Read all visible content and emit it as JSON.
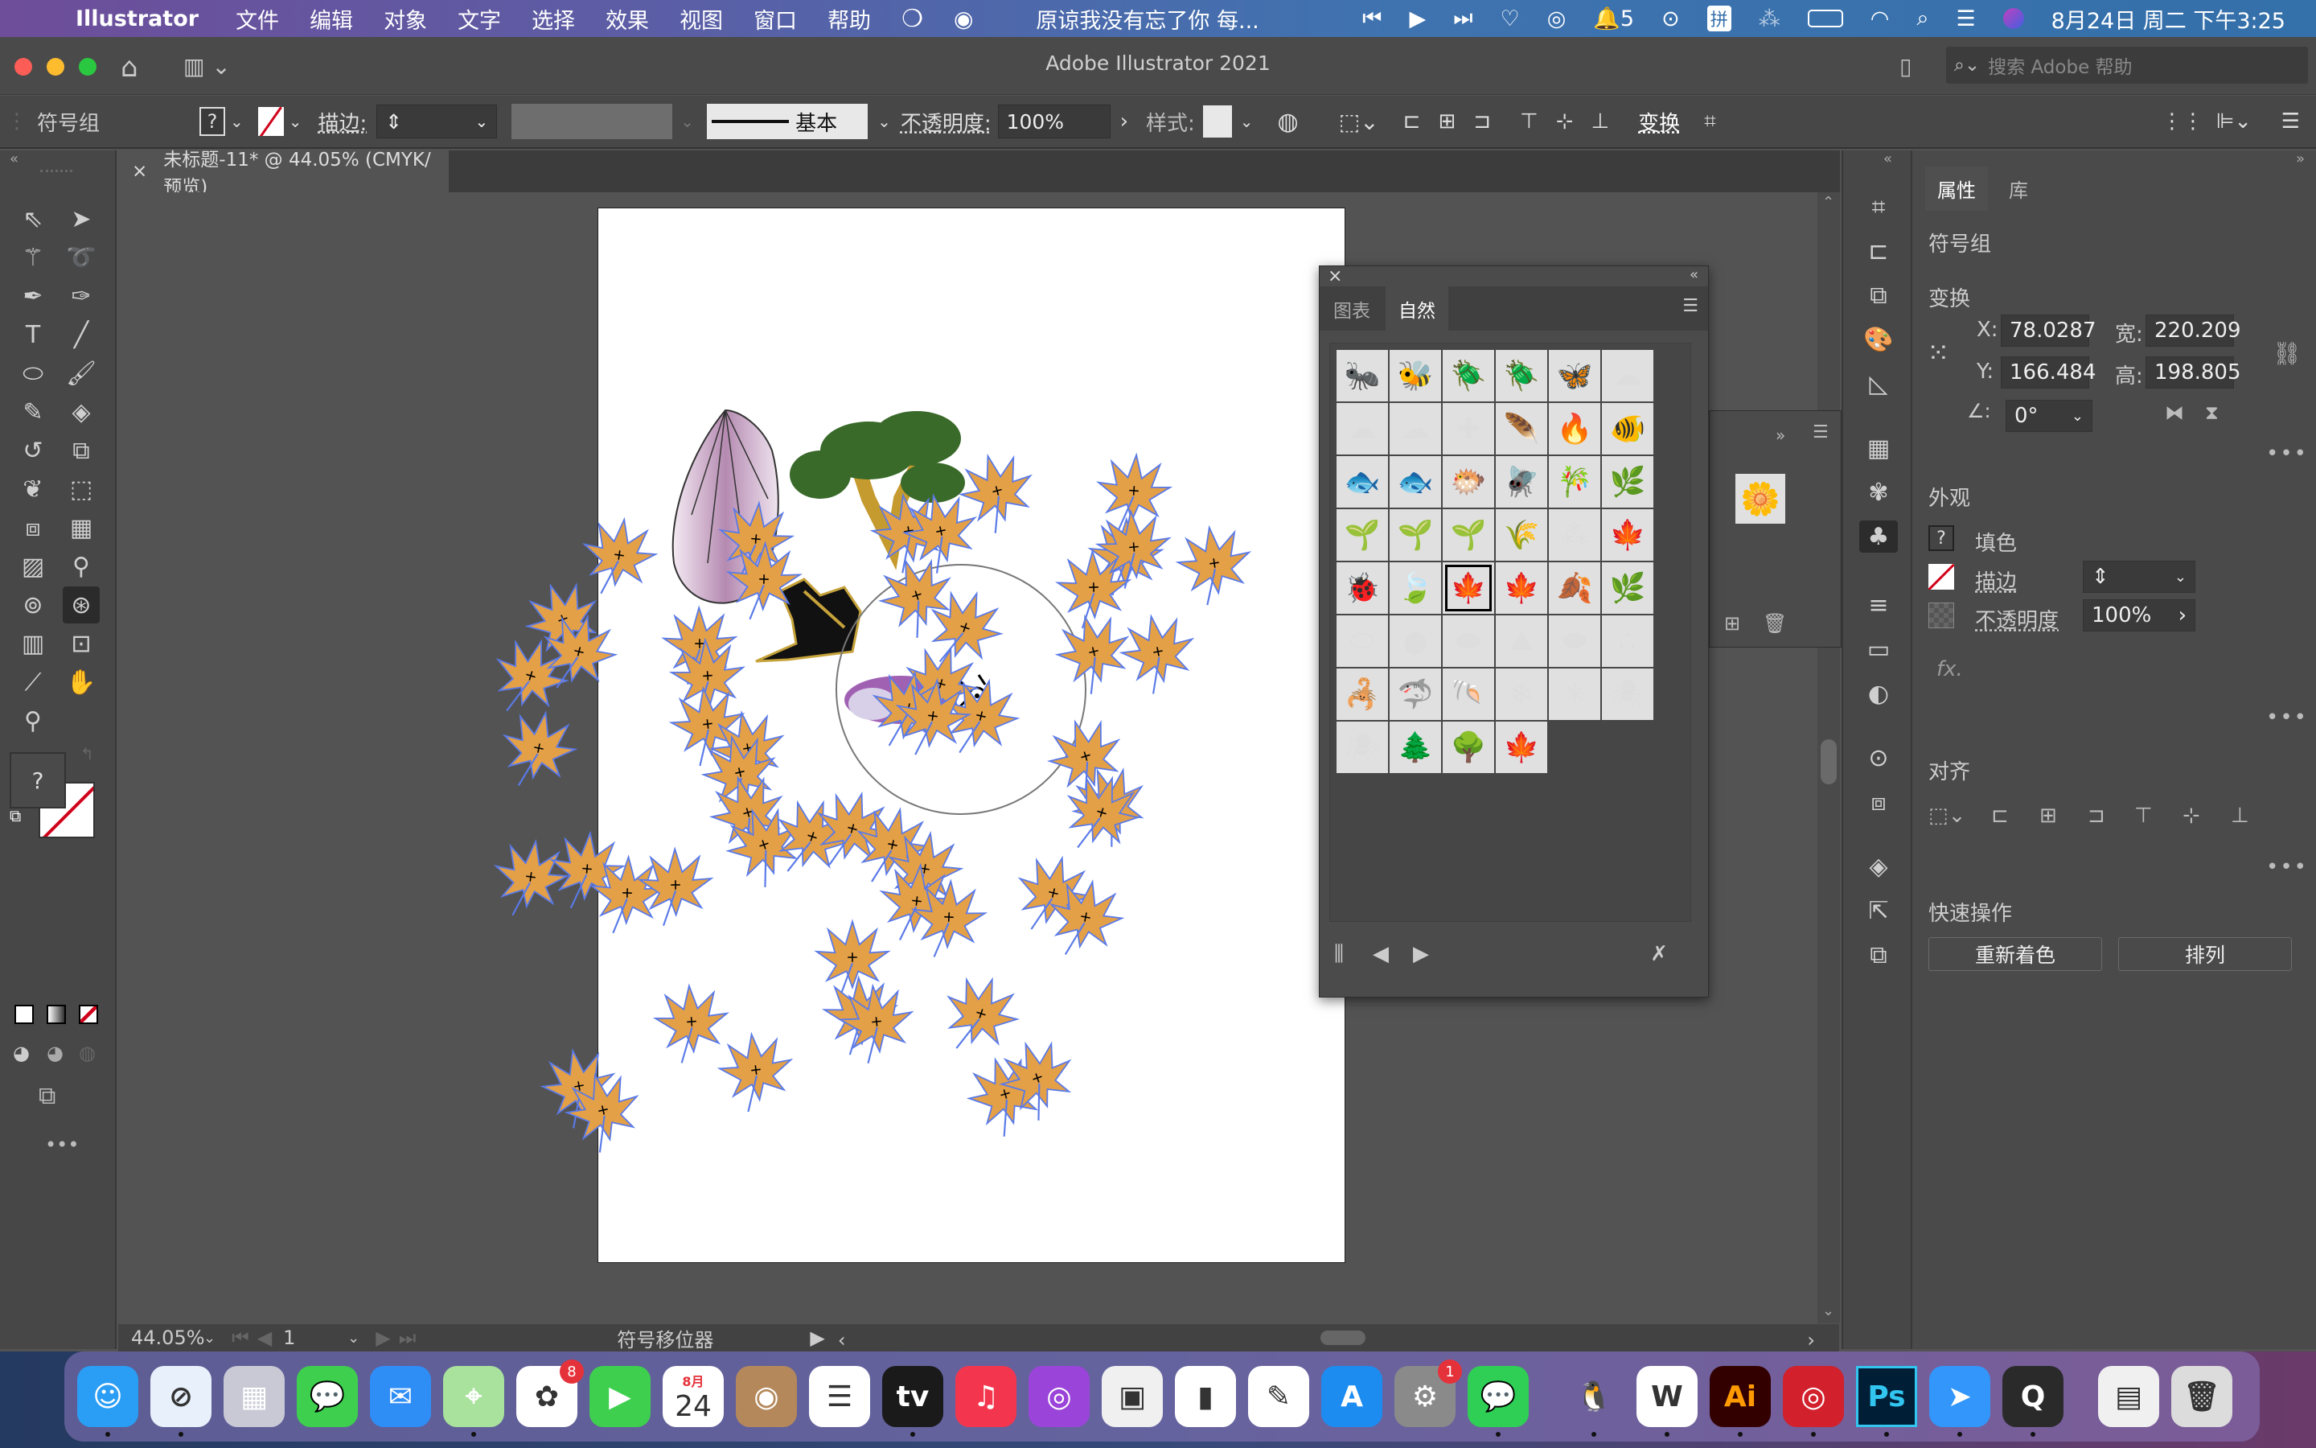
{
  "menubar": {
    "app_name": "Illustrator",
    "menus": [
      "文件",
      "编辑",
      "对象",
      "文字",
      "选择",
      "效果",
      "视图",
      "窗口",
      "帮助"
    ],
    "now_playing": "原谅我没有忘了你 每...",
    "qq_count": "5",
    "input_method": "拼",
    "datetime": "8月24日 周二 下午3:25"
  },
  "window": {
    "title": "Adobe Illustrator 2021",
    "search_placeholder": "搜索 Adobe 帮助"
  },
  "control_bar": {
    "selection_type": "符号组",
    "fill_swatch": "?",
    "stroke_label": "描边:",
    "stroke_profile": "基本",
    "opacity_label": "不透明度:",
    "opacity_value": "100%",
    "style_label": "样式:",
    "transform_label": "变换"
  },
  "document_tab": {
    "title": "未标题-11* @ 44.05% (CMYK/预览)"
  },
  "status_bar": {
    "zoom": "44.05%",
    "artboard_number": "1",
    "current_tool": "符号移位器"
  },
  "symbols_panel": {
    "tabs": [
      {
        "label": "图表",
        "active": false
      },
      {
        "label": "自然",
        "active": true
      }
    ],
    "symbols": [
      {
        "name": "ant",
        "glyph": "🐜"
      },
      {
        "name": "wasp",
        "glyph": "🐝"
      },
      {
        "name": "red-beetle",
        "glyph": "🪲"
      },
      {
        "name": "green-beetle",
        "glyph": "🪲"
      },
      {
        "name": "butterfly",
        "glyph": "🦋"
      },
      {
        "name": "cloud-1",
        "glyph": "☁"
      },
      {
        "name": "cloud-2",
        "glyph": "☁"
      },
      {
        "name": "cloud-3",
        "glyph": "☁"
      },
      {
        "name": "dragonfly",
        "glyph": "✚"
      },
      {
        "name": "feather",
        "glyph": "🪶"
      },
      {
        "name": "fire",
        "glyph": "🔥"
      },
      {
        "name": "orange-fish",
        "glyph": "🐠"
      },
      {
        "name": "angelfish",
        "glyph": "🐟"
      },
      {
        "name": "mahi-fish",
        "glyph": "🐟"
      },
      {
        "name": "purple-fish",
        "glyph": "🐡"
      },
      {
        "name": "fly",
        "glyph": "🪰"
      },
      {
        "name": "bamboo",
        "glyph": "🎋"
      },
      {
        "name": "green-plant",
        "glyph": "🌿"
      },
      {
        "name": "grass-1",
        "glyph": "🌱"
      },
      {
        "name": "grass-2",
        "glyph": "🌱"
      },
      {
        "name": "grass-3",
        "glyph": "🌱"
      },
      {
        "name": "grass-strip",
        "glyph": "🌾"
      },
      {
        "name": "scattered-leaves",
        "glyph": "⁂"
      },
      {
        "name": "yellow-maple",
        "glyph": "🍁"
      },
      {
        "name": "ladybug",
        "glyph": "🐞"
      },
      {
        "name": "green-leaf",
        "glyph": "🍃"
      },
      {
        "name": "orange-maple",
        "glyph": "🍁",
        "selected": true
      },
      {
        "name": "red-maple",
        "glyph": "🍁"
      },
      {
        "name": "brown-maple",
        "glyph": "🍂"
      },
      {
        "name": "oak-leaf",
        "glyph": "🌿"
      },
      {
        "name": "pebble-1",
        "glyph": "⬭"
      },
      {
        "name": "pebble-2",
        "glyph": "●"
      },
      {
        "name": "stone-flat",
        "glyph": "⬬"
      },
      {
        "name": "rock",
        "glyph": "⛰"
      },
      {
        "name": "stone-round",
        "glyph": "⬬"
      },
      {
        "name": "sand",
        "glyph": "∴"
      },
      {
        "name": "scorpion",
        "glyph": "🦂"
      },
      {
        "name": "shark",
        "glyph": "🦈"
      },
      {
        "name": "nautilus",
        "glyph": "🐚"
      },
      {
        "name": "snowflake-1",
        "glyph": "❄"
      },
      {
        "name": "snowflake-2",
        "glyph": "✳"
      },
      {
        "name": "blue-spider",
        "glyph": "🕷"
      },
      {
        "name": "brown-spider",
        "glyph": "🕷"
      },
      {
        "name": "pine-tree",
        "glyph": "🌲"
      },
      {
        "name": "birch-trees",
        "glyph": "🌳"
      },
      {
        "name": "green-maple",
        "glyph": "🍁"
      }
    ]
  },
  "properties_panel": {
    "tabs": [
      {
        "label": "属性",
        "active": true
      },
      {
        "label": "库",
        "active": false
      }
    ],
    "selection_type": "符号组",
    "transform": {
      "heading": "变换",
      "x_label": "X:",
      "x": "78.0287",
      "y_label": "Y:",
      "y": "166.484",
      "w_label": "宽:",
      "w": "220.209",
      "h_label": "高:",
      "h": "198.805",
      "angle": "0°"
    },
    "appearance": {
      "heading": "外观",
      "fill_label": "填色",
      "fill_swatch": "?",
      "stroke_label": "描边",
      "opacity_label": "不透明度",
      "opacity_value": "100%",
      "fx_label": "fx."
    },
    "align": {
      "heading": "对齐"
    },
    "quick_actions": {
      "heading": "快速操作",
      "recolor": "重新着色",
      "arrange": "排列"
    }
  },
  "dock": {
    "apps": [
      {
        "name": "finder",
        "label": "☺",
        "bg": "#2a9df4",
        "running": true
      },
      {
        "name": "safari",
        "label": "⊘",
        "bg": "#e8f1fb",
        "running": true
      },
      {
        "name": "launchpad",
        "label": "▦",
        "bg": "#c9c9d6",
        "running": false
      },
      {
        "name": "messages",
        "label": "💬",
        "bg": "#3ecf4f",
        "running": false
      },
      {
        "name": "mail",
        "label": "✉",
        "bg": "#2f8df6",
        "running": false
      },
      {
        "name": "maps",
        "label": "⌖",
        "bg": "#a8e29c",
        "running": true
      },
      {
        "name": "photos",
        "label": "✿",
        "bg": "#ffffff",
        "running": false,
        "badge": "8"
      },
      {
        "name": "facetime",
        "label": "▶",
        "bg": "#3ecf4f",
        "running": false
      },
      {
        "name": "calendar",
        "label": "24",
        "bg": "#ffffff",
        "running": false,
        "month": "8月"
      },
      {
        "name": "contacts",
        "label": "◉",
        "bg": "#b4885a",
        "running": false
      },
      {
        "name": "reminders",
        "label": "☰",
        "bg": "#ffffff",
        "running": false
      },
      {
        "name": "apple-tv",
        "label": "tv",
        "bg": "#1a1a1a",
        "running": true
      },
      {
        "name": "music",
        "label": "♫",
        "bg": "#f3364e",
        "running": false
      },
      {
        "name": "podcasts",
        "label": "◎",
        "bg": "#9b44d9",
        "running": false
      },
      {
        "name": "keynote",
        "label": "▣",
        "bg": "#f0f0f0",
        "running": false
      },
      {
        "name": "numbers",
        "label": "▮",
        "bg": "#ffffff",
        "running": false
      },
      {
        "name": "pages",
        "label": "✎",
        "bg": "#ffffff",
        "running": false
      },
      {
        "name": "app-store",
        "label": "A",
        "bg": "#1d8cf0",
        "running": false
      },
      {
        "name": "system-preferences",
        "label": "⚙",
        "bg": "#8a8a8a",
        "running": false,
        "badge": "1"
      },
      {
        "name": "wechat",
        "label": "💬",
        "bg": "#2fcf55",
        "running": true
      },
      {
        "name": "qq",
        "label": "🐧",
        "bg": "transparent",
        "running": true
      },
      {
        "name": "wps",
        "label": "W",
        "bg": "#ffffff",
        "running": true
      },
      {
        "name": "illustrator",
        "label": "Ai",
        "bg": "#330000",
        "running": true
      },
      {
        "name": "netease-music",
        "label": "◎",
        "bg": "#d2202c",
        "running": true
      },
      {
        "name": "photoshop",
        "label": "Ps",
        "bg": "#001e36",
        "running": true
      },
      {
        "name": "dingtalk",
        "label": "➤",
        "bg": "#3296fa",
        "running": true
      },
      {
        "name": "quicktime",
        "label": "Q",
        "bg": "#2a2a2a",
        "running": true
      },
      {
        "name": "document",
        "label": "▤",
        "bg": "#f0f0f0",
        "running": false
      },
      {
        "name": "trash",
        "label": "🗑",
        "bg": "#dcdcdc",
        "running": false
      }
    ]
  },
  "colors": {
    "leaf_fill": "#e3a047",
    "selection_blue": "#4a74f0",
    "stroke_none_red": "#d0021b"
  }
}
